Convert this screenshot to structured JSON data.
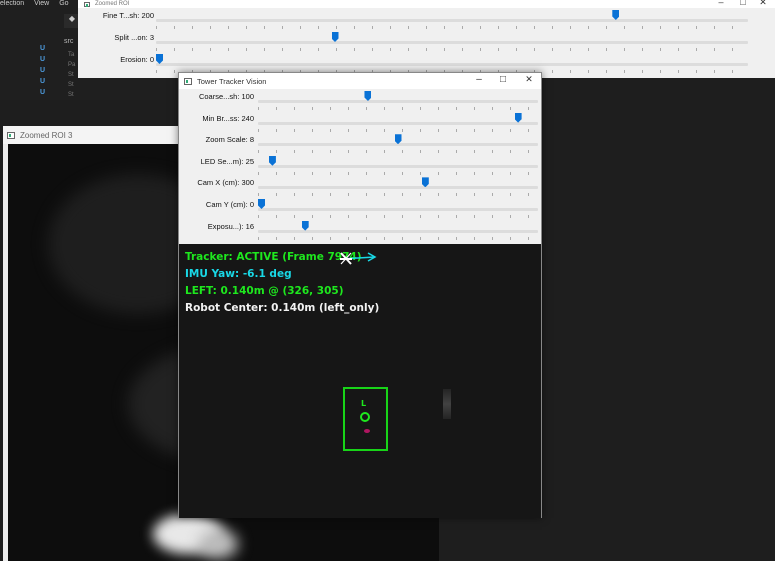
{
  "editor": {
    "menu": [
      "election",
      "View",
      "Go"
    ],
    "src_label": "src",
    "gutter": [
      "U",
      "U",
      "U",
      "U",
      "U"
    ],
    "line_hints": [
      "Ta",
      "Pa",
      "St",
      "St",
      "St"
    ]
  },
  "roi_top": {
    "title": "Zoomed ROI",
    "trackbars": [
      {
        "label": "Fine T...sh: 200",
        "fraction": 0.78
      },
      {
        "label": "Split ...on: 3",
        "fraction": 0.3
      },
      {
        "label": "Erosion: 0",
        "fraction": 0.0
      }
    ]
  },
  "roi3": {
    "title": "Zoomed ROI 3"
  },
  "main": {
    "title": "Tower Tracker Vision",
    "controls": {
      "minimize": "–",
      "maximize": "□",
      "close": "✕"
    },
    "trackbars": [
      {
        "label": "Coarse...sh: 100",
        "fraction": 0.39
      },
      {
        "label": "Min Br...ss: 240",
        "fraction": 0.94
      },
      {
        "label": "Zoom Scale: 8",
        "fraction": 0.5
      },
      {
        "label": "LED Se...m): 25",
        "fraction": 0.04
      },
      {
        "label": "Cam X (cm): 300",
        "fraction": 0.6
      },
      {
        "label": "Cam Y (cm): 0",
        "fraction": 0.0
      },
      {
        "label": "Exposu...): 16",
        "fraction": 0.16
      }
    ],
    "overlay": {
      "tracker": "Tracker: ACTIVE (Frame 7974)",
      "imu": "IMU Yaw: -6.1 deg",
      "left": "LEFT: 0.140m @ (326, 305)",
      "robot": "Robot Center: 0.140m (left_only)",
      "box_label": "L"
    },
    "colors": {
      "green": "#1ee81e",
      "cyan": "#19d8e6",
      "white": "#f2f2f2",
      "thumb": "#0a72d6"
    }
  }
}
